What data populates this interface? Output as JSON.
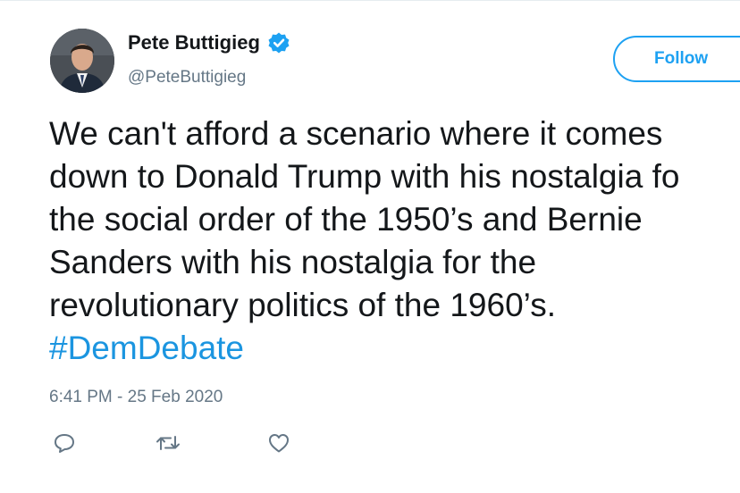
{
  "author": {
    "display_name": "Pete Buttigieg",
    "handle": "@PeteButtigieg",
    "verified": true
  },
  "follow_button": {
    "label": "Follow"
  },
  "tweet": {
    "lines": [
      "We can't afford a scenario where it comes",
      "down to Donald Trump with his nostalgia fo",
      "the social order of the 1950’s and Bernie",
      "Sanders with his nostalgia for the",
      "revolutionary politics of the 1960’s."
    ],
    "hashtag": "#DemDebate",
    "timestamp": "6:41 PM - 25 Feb 2020"
  },
  "actions": [
    {
      "icon": "reply-icon"
    },
    {
      "icon": "retweet-icon"
    },
    {
      "icon": "like-icon"
    }
  ],
  "colors": {
    "accent": "#1da1f2",
    "hashtag": "#1b95e0",
    "secondary_text": "#657786",
    "primary_text": "#14171a"
  }
}
